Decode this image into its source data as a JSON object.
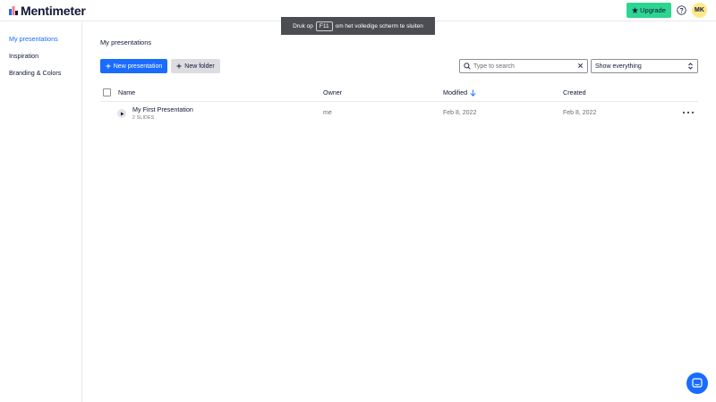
{
  "header": {
    "logo_text": "Mentimeter",
    "upgrade_label": "Upgrade",
    "avatar_initials": "MK"
  },
  "toast": {
    "before": "Druk op",
    "key": "F11",
    "after": "om het volledige scherm te sluiten"
  },
  "sidebar": {
    "items": [
      {
        "label": "My presentations",
        "active": true
      },
      {
        "label": "Inspiration",
        "active": false
      },
      {
        "label": "Branding & Colors",
        "active": false
      }
    ]
  },
  "main": {
    "title": "My presentations",
    "new_presentation_label": "New presentation",
    "new_folder_label": "New folder",
    "search_placeholder": "Type to search",
    "filter_value": "Show everything",
    "columns": {
      "name": "Name",
      "owner": "Owner",
      "modified": "Modified",
      "created": "Created"
    },
    "rows": [
      {
        "title": "My First Presentation",
        "subtitle": "2 SLIDES",
        "owner": "me",
        "modified": "Feb 8, 2022",
        "created": "Feb 8, 2022"
      }
    ]
  },
  "colors": {
    "accent": "#196cff",
    "upgrade": "#2dd591",
    "avatar": "#fce98b"
  },
  "icons": [
    "mentimeter-logo-icon",
    "star-icon",
    "help-icon",
    "plus-icon",
    "search-icon",
    "close-icon",
    "chevron-updown-icon",
    "arrow-down-icon",
    "play-icon",
    "more-icon",
    "chat-icon"
  ]
}
